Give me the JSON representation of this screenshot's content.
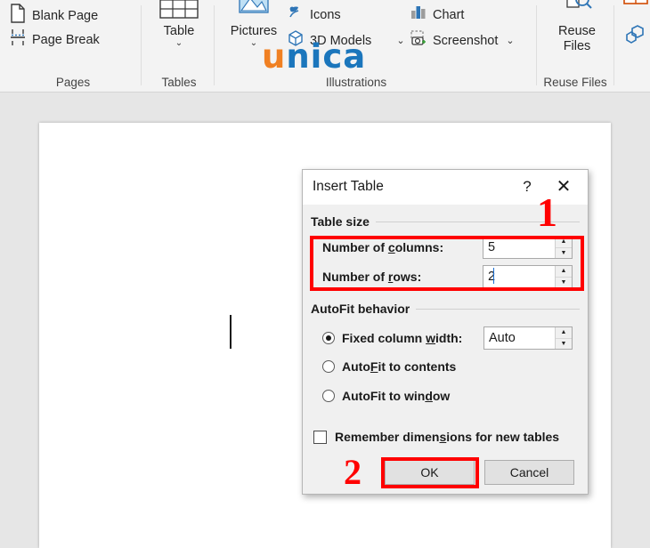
{
  "ribbon": {
    "groups": [
      {
        "label": "Pages"
      },
      {
        "label": "Tables"
      },
      {
        "label": "Illustrations"
      },
      {
        "label": "Reuse Files"
      }
    ],
    "pages": {
      "blank_page": "Blank Page",
      "page_break": "Page Break"
    },
    "tables": {
      "table": "Table",
      "caret": "⌄"
    },
    "illustrations": {
      "pictures": "Pictures",
      "pictures_caret": "⌄",
      "icons": "Icons",
      "models_3d": "3D Models",
      "models_3d_caret": "⌄",
      "chart": "Chart",
      "screenshot": "Screenshot",
      "screenshot_caret": "⌄"
    },
    "reuse": {
      "line1": "Reuse",
      "line2": "Files"
    }
  },
  "watermark": {
    "part_orange": "u",
    "part_blue": "nica"
  },
  "dialog": {
    "title": "Insert Table",
    "help_glyph": "?",
    "close_glyph": "✕",
    "table_size": {
      "legend": "Table size",
      "columns_label_pre": "Number of ",
      "columns_label_underline": "c",
      "columns_label_post": "olumns:",
      "columns_value": "5",
      "rows_label_pre": "Number of ",
      "rows_label_underline": "r",
      "rows_label_post": "ows:",
      "rows_value": "2"
    },
    "autofit": {
      "legend": "AutoFit behavior",
      "option1_pre": "Fixed column ",
      "option1_underline": "w",
      "option1_post": "idth:",
      "option1_selected": true,
      "width_value": "Auto",
      "option2_pre": "Auto",
      "option2_underline": "F",
      "option2_post": "it to contents",
      "option3_pre": "AutoFit to win",
      "option3_underline": "d",
      "option3_post": "ow"
    },
    "remember": {
      "label_pre": "Remember dimen",
      "label_underline": "s",
      "label_post": "ions for new tables",
      "checked": false
    },
    "buttons": {
      "ok": "OK",
      "cancel": "Cancel"
    },
    "spin_up": "▲",
    "spin_down": "▼"
  },
  "annotations": {
    "step1": "1",
    "step2": "2",
    "color": "#ff0000"
  }
}
